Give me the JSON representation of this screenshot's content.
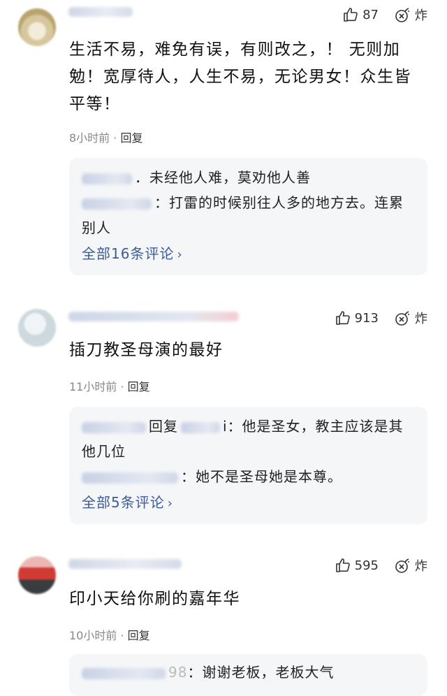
{
  "comments": [
    {
      "likes": "87",
      "boom_label": "炸",
      "text": "生活不易，难免有误，有则改之，！ 无则加勉！宽厚待人，人生不易，无论男女！众生皆平等！",
      "time": "8小时前",
      "reply_label": "回复",
      "replies": [
        {
          "text": "．未经他人难，莫劝他人善"
        },
        {
          "text": "：打雷的时候别往人多的地方去。连累别人"
        }
      ],
      "see_all": "全部16条评论"
    },
    {
      "likes": "913",
      "boom_label": "炸",
      "text": "插刀教圣母演的最好",
      "time": "11小时前",
      "reply_label": "回复",
      "replies": [
        {
          "prefix": "回复",
          "suffix": "i",
          "text": "：他是圣女，教主应该是其他几位"
        },
        {
          "text": "：她不是圣母她是本尊。"
        }
      ],
      "see_all": "全部5条评论"
    },
    {
      "likes": "595",
      "boom_label": "炸",
      "text": "印小天给你刷的嘉年华",
      "time": "10小时前",
      "reply_label": "回复",
      "replies": [
        {
          "suffix": "98",
          "text": "：谢谢老板，老板大气"
        }
      ]
    }
  ],
  "icons": {
    "like": "thumbs-up-icon",
    "boom": "bomb-icon",
    "chevron": "chevron-right-icon"
  },
  "colors": {
    "text": "#111111",
    "meta": "#888888",
    "link": "#3b5b9a",
    "reply_bg": "#f5f6f8"
  }
}
